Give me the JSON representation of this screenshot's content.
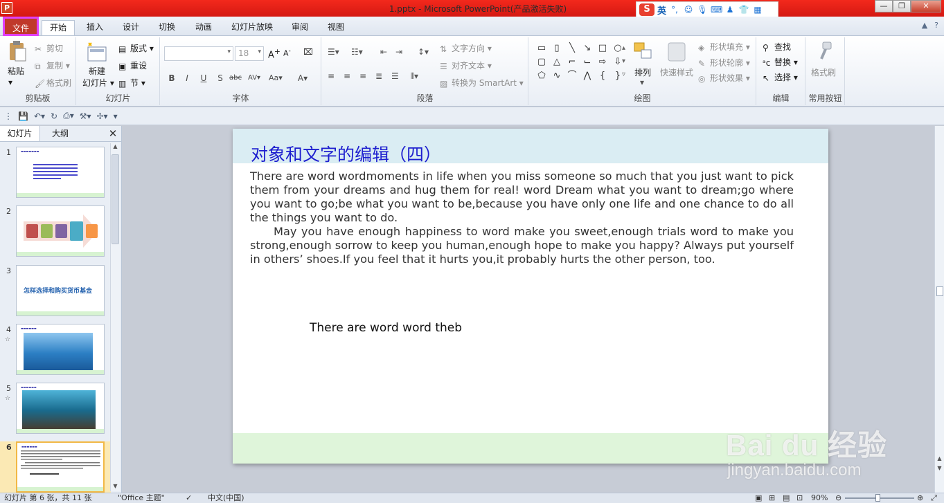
{
  "window": {
    "app_icon": "P",
    "title": "1.pptx - Microsoft PowerPoint(产品激活失败)",
    "ime": {
      "lang": "英",
      "punct": "°,"
    }
  },
  "tabs": [
    {
      "label": "文件"
    },
    {
      "label": "开始"
    },
    {
      "label": "插入"
    },
    {
      "label": "设计"
    },
    {
      "label": "切换"
    },
    {
      "label": "动画"
    },
    {
      "label": "幻灯片放映"
    },
    {
      "label": "审阅"
    },
    {
      "label": "视图"
    }
  ],
  "ribbon": {
    "clipboard": {
      "label": "剪贴板",
      "paste": "粘贴",
      "cut": "剪切",
      "copy": "复制",
      "format_painter": "格式刷"
    },
    "slides": {
      "label": "幻灯片",
      "new_slide": "新建",
      "new_slide2": "幻灯片",
      "layout": "版式",
      "reset": "重设",
      "section": "节"
    },
    "font": {
      "label": "字体",
      "font_size": "18"
    },
    "paragraph": {
      "label": "段落",
      "text_direction": "文字方向",
      "align_text": "对齐文本",
      "smartart": "转换为 SmartArt"
    },
    "drawing": {
      "label": "绘图",
      "arrange": "排列",
      "quick_styles": "快速样式",
      "shape_fill": "形状填充",
      "shape_outline": "形状轮廓",
      "shape_effects": "形状效果"
    },
    "editing": {
      "label": "编辑",
      "find": "查找",
      "replace": "替换",
      "select": "选择"
    },
    "common": {
      "label": "常用按钮",
      "format_painter": "格式刷"
    }
  },
  "panel": {
    "tab_slides": "幻灯片",
    "tab_outline": "大纲",
    "thumbnails": [
      {
        "num": "1",
        "star": ""
      },
      {
        "num": "2",
        "star": ""
      },
      {
        "num": "3",
        "star": "",
        "title": "怎样选择和购买货币基金"
      },
      {
        "num": "4",
        "star": "☆"
      },
      {
        "num": "5",
        "star": "☆"
      },
      {
        "num": "6",
        "star": ""
      }
    ]
  },
  "slide": {
    "title": "对象和文字的编辑（四）",
    "para1": "There are  word wordmoments in life when you miss someone so much that you just want to pick them from your dreams and hug them for real!  word  Dream what you want to dream;go where you want to go;be what you want to be,because you have only one life and one chance to do all the things you want to do.",
    "para2": "May you have enough happiness to  word  make you sweet,enough trials  word  to make you strong,enough sorrow to keep you human,enough hope to make you happy? Always put yourself in others’ shoes.If you feel that it hurts you,it probably hurts the other person, too.",
    "textbox": "There are word word theb"
  },
  "watermark": {
    "main": "Bai du 经验",
    "sub": "jingyan.baidu.com"
  },
  "status": {
    "slide_info": "幻灯片 第 6 张，共 11 张",
    "theme": "\"Office 主题\"",
    "language": "中文(中国)",
    "zoom": "90%"
  }
}
